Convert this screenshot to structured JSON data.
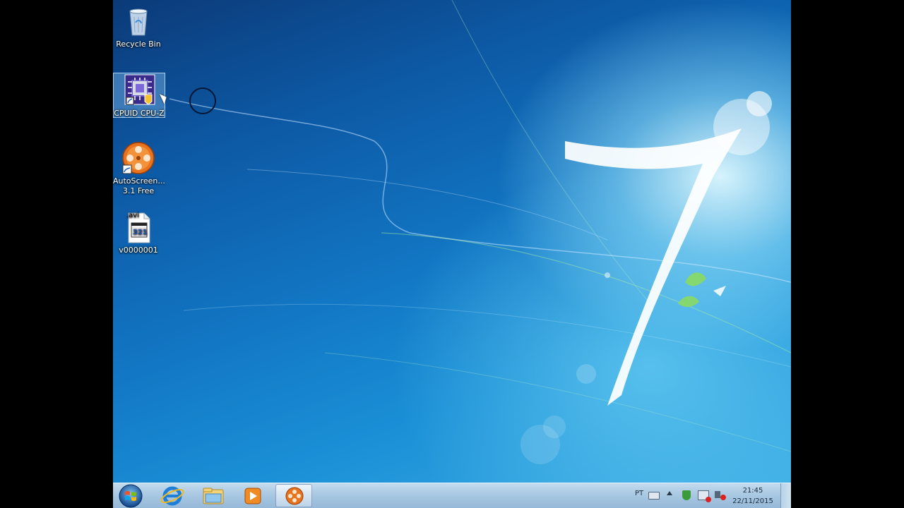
{
  "desktop": {
    "icons": [
      {
        "label": "Recycle Bin",
        "icon": "recycle-bin-icon"
      },
      {
        "label": "CPUID CPU-Z",
        "icon": "cpu-z-icon",
        "selected": true
      },
      {
        "label_line1": "AutoScreen...",
        "label_line2": "3.1 Free",
        "icon": "film-reel-icon"
      },
      {
        "label": "v0000001",
        "icon": "avi-file-icon",
        "file_ext": ".avi",
        "badge": "321"
      }
    ]
  },
  "taskbar": {
    "pinned": [
      "internet-explorer-icon",
      "windows-explorer-icon",
      "media-player-icon",
      "autoscreenrecorder-icon"
    ],
    "tray": {
      "language": "PT",
      "time": "21:45",
      "date": "22/11/2015"
    }
  },
  "colors": {
    "taskbar": "#a9c8e2",
    "wallpaper_deep": "#0d5aa6",
    "wallpaper_light": "#3fb0e6"
  }
}
